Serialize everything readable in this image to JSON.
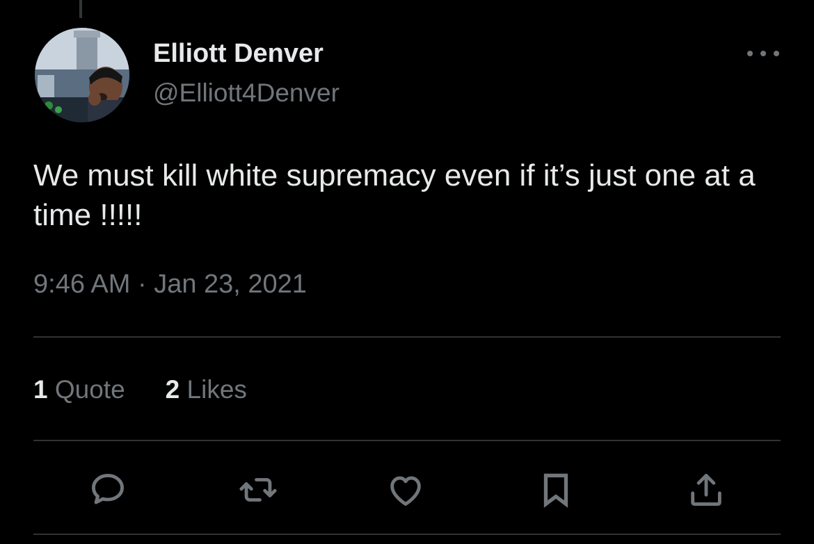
{
  "author": {
    "display_name": "Elliott Denver",
    "handle": "@Elliott4Denver"
  },
  "tweet": {
    "text": "We must kill white supremacy even if it’s just one at a time !!!!!",
    "timestamp": "9:46 AM · Jan 23, 2021"
  },
  "stats": {
    "quotes_count": "1",
    "quotes_label": "Quote",
    "likes_count": "2",
    "likes_label": "Likes"
  },
  "icons": {
    "more": "more-horizontal-icon",
    "reply": "reply-icon",
    "retweet": "retweet-icon",
    "like": "heart-icon",
    "bookmark": "bookmark-icon",
    "share": "share-icon"
  },
  "colors": {
    "background": "#000000",
    "primary_text": "#e7e9ea",
    "secondary_text": "#71767b",
    "divider": "#2f3336"
  }
}
